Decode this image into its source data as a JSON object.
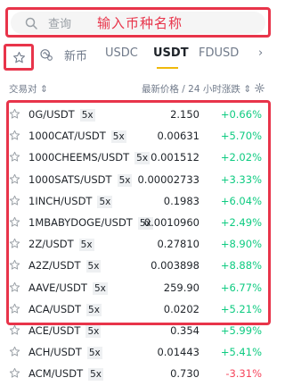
{
  "search": {
    "placeholder": "查询",
    "annotation": "输入币种名称"
  },
  "tabs": [
    {
      "label": "新币",
      "active": false
    },
    {
      "label": "USDC",
      "active": false
    },
    {
      "label": "USDT",
      "active": true
    },
    {
      "label": "FDUSD",
      "active": false
    }
  ],
  "tab_more_icon": "chevron-right-icon",
  "header": {
    "pair": "交易对",
    "price_change": "最新价格 / 24 小时涨跌"
  },
  "colors": {
    "highlight": "#e8344a",
    "up": "#0ecb81",
    "down": "#f6465d",
    "accent": "#f0b90b"
  },
  "rows": [
    {
      "pair": "0G/USDT",
      "lev": "5x",
      "price": "2.150",
      "change": "+0.66%",
      "dir": "up"
    },
    {
      "pair": "1000CAT/USDT",
      "lev": "5x",
      "price": "0.00631",
      "change": "+5.70%",
      "dir": "up"
    },
    {
      "pair": "1000CHEEMS/USDT",
      "lev": "5x",
      "price": "0.001512",
      "change": "+2.02%",
      "dir": "up"
    },
    {
      "pair": "1000SATS/USDT",
      "lev": "5x",
      "price": "0.00002733",
      "change": "+3.33%",
      "dir": "up"
    },
    {
      "pair": "1INCH/USDT",
      "lev": "5x",
      "price": "0.1983",
      "change": "+6.04%",
      "dir": "up"
    },
    {
      "pair": "1MBABYDOGE/USDT",
      "lev": "5x",
      "price": "0.0010960",
      "change": "+2.49%",
      "dir": "up"
    },
    {
      "pair": "2Z/USDT",
      "lev": "5x",
      "price": "0.27810",
      "change": "+8.90%",
      "dir": "up"
    },
    {
      "pair": "A2Z/USDT",
      "lev": "5x",
      "price": "0.003898",
      "change": "+8.88%",
      "dir": "up"
    },
    {
      "pair": "AAVE/USDT",
      "lev": "5x",
      "price": "259.90",
      "change": "+6.77%",
      "dir": "up"
    },
    {
      "pair": "ACA/USDT",
      "lev": "5x",
      "price": "0.0202",
      "change": "+5.21%",
      "dir": "up"
    },
    {
      "pair": "ACE/USDT",
      "lev": "5x",
      "price": "0.354",
      "change": "+5.99%",
      "dir": "up"
    },
    {
      "pair": "ACH/USDT",
      "lev": "5x",
      "price": "0.01443",
      "change": "+5.41%",
      "dir": "up"
    },
    {
      "pair": "ACM/USDT",
      "lev": "5x",
      "price": "0.730",
      "change": "-3.31%",
      "dir": "down"
    }
  ]
}
